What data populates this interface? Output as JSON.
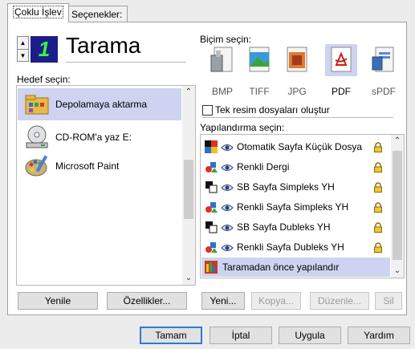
{
  "tabs": [
    {
      "label": "Çoklu İşlev",
      "active": true
    },
    {
      "label": "Seçenekler:",
      "active": false
    }
  ],
  "mode": {
    "number": "1",
    "title": "Tarama"
  },
  "destination": {
    "label": "Hedef seçin:",
    "items": [
      {
        "label": "Depolamaya aktarma",
        "icon": "folder-storage-icon",
        "selected": true
      },
      {
        "label": "CD-ROM'a yaz  E:",
        "icon": "cd-rom-icon",
        "selected": false
      },
      {
        "label": "Microsoft Paint",
        "icon": "paint-palette-icon",
        "selected": false
      }
    ],
    "buttons": {
      "refresh": "Yenile",
      "properties": "Özellikler..."
    }
  },
  "format": {
    "label": "Biçim seçin:",
    "items": [
      {
        "label": "BMP",
        "icon": "bmp-icon",
        "selected": false
      },
      {
        "label": "TIFF",
        "icon": "tiff-icon",
        "selected": false
      },
      {
        "label": "JPG",
        "icon": "jpg-icon",
        "selected": false
      },
      {
        "label": "PDF",
        "icon": "pdf-icon",
        "selected": true
      },
      {
        "label": "sPDF",
        "icon": "spdf-icon",
        "selected": false
      }
    ],
    "single_file_checkbox": {
      "label": "Tek resim dosyaları oluştur",
      "checked": false
    }
  },
  "configuration": {
    "label": "Yapılandırma seçin:",
    "items": [
      {
        "label": "Otomatik Sayfa Küçük Dosya",
        "icon": "auto-color-icon",
        "locked": true,
        "selected": false
      },
      {
        "label": "Renkli Dergi",
        "icon": "color-shapes-icon",
        "locked": true,
        "selected": false
      },
      {
        "label": "SB Sayfa Simpleks YH",
        "icon": "bw-icon",
        "locked": true,
        "selected": false
      },
      {
        "label": "Renkli Sayfa Simpleks YH",
        "icon": "color-shapes-icon",
        "locked": true,
        "selected": false
      },
      {
        "label": "SB Sayfa Dubleks YH",
        "icon": "bw-icon",
        "locked": true,
        "selected": false
      },
      {
        "label": "Renkli Sayfa Dubleks YH",
        "icon": "color-shapes-icon",
        "locked": true,
        "selected": false
      },
      {
        "label": "Taramadan önce yapılandır",
        "icon": "configure-before-scan-icon",
        "locked": false,
        "selected": true
      }
    ],
    "buttons": {
      "new": "Yeni...",
      "copy": "Kopya...",
      "edit": "Düzenle...",
      "delete": "Sil"
    }
  },
  "footer": {
    "ok": "Tamam",
    "cancel": "İptal",
    "apply": "Uygula",
    "help": "Yardım"
  },
  "colors": {
    "selection": "#cdd3f0",
    "lcd_bg": "#1b1e8a",
    "lcd_fg": "#3cf53c"
  }
}
